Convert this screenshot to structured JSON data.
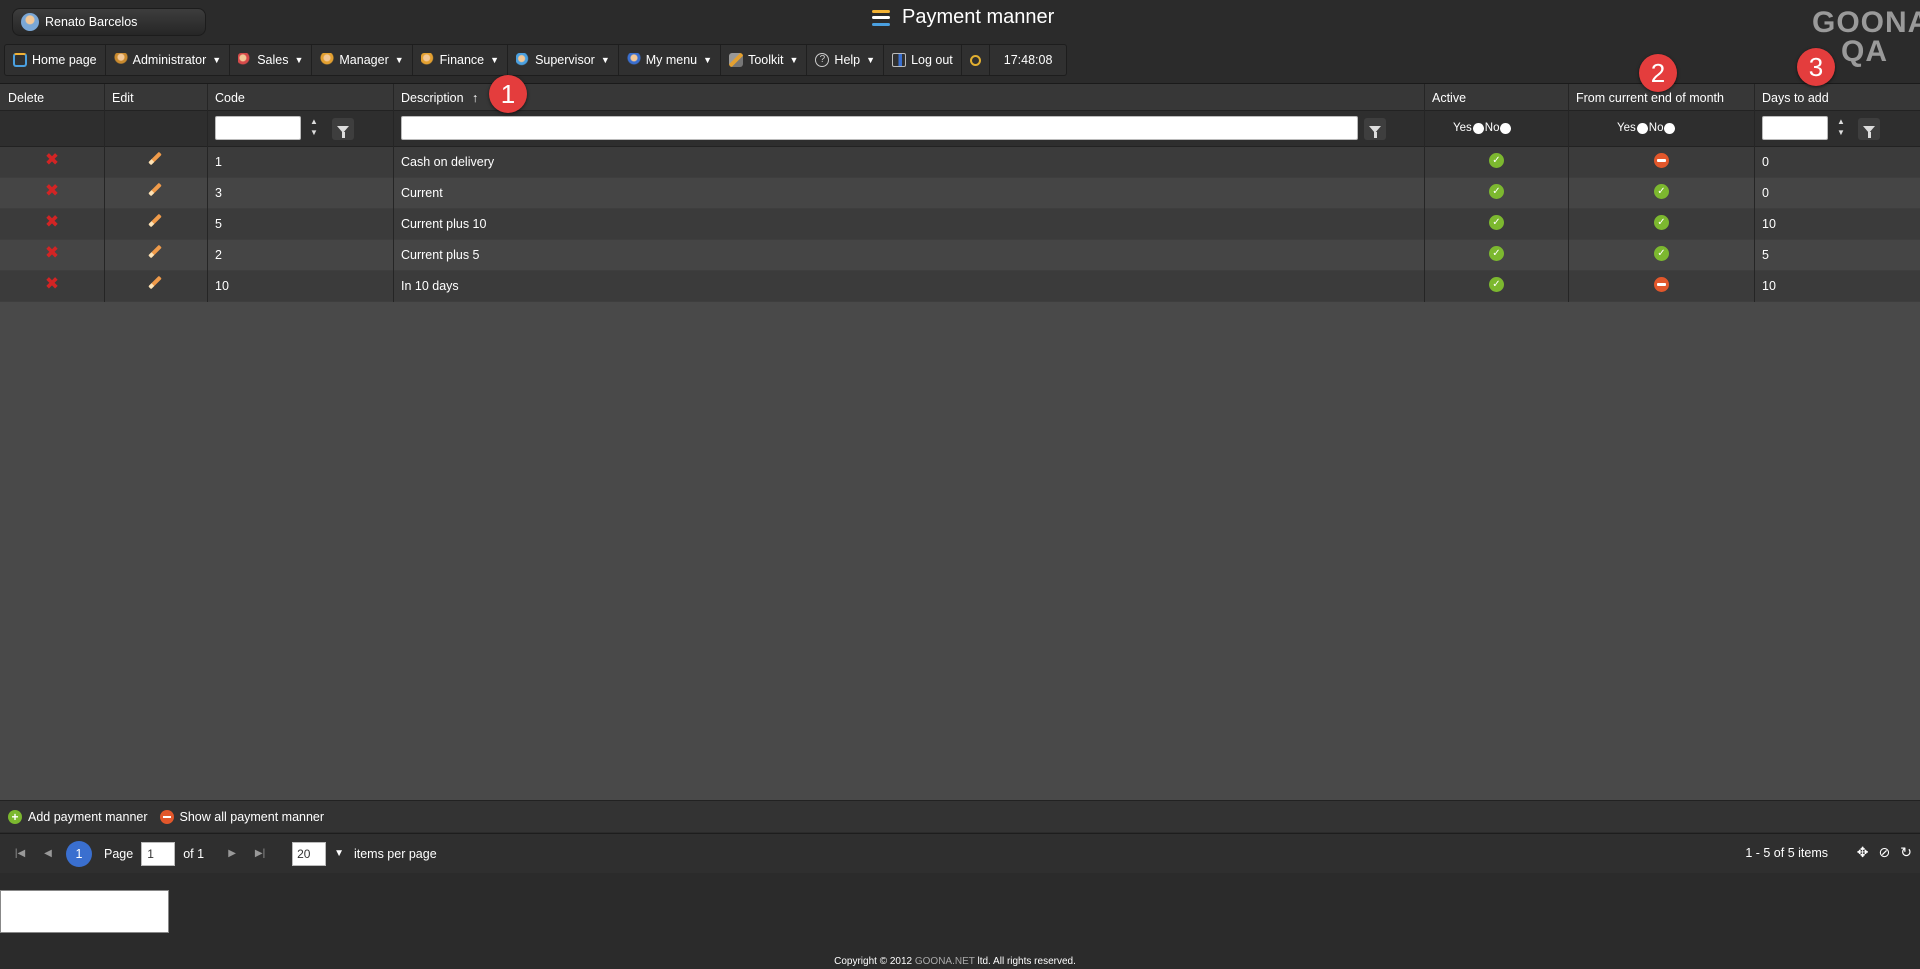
{
  "user": {
    "name": "Renato Barcelos"
  },
  "header": {
    "title": "Payment manner",
    "menu_icon_colors": [
      "#f2b234",
      "#ffffff",
      "#4aa0e0"
    ]
  },
  "logo": {
    "line1": "GOONA",
    "line2": "QA"
  },
  "nav": [
    {
      "label": "Home page",
      "icon": "home-icon",
      "dropdown": false
    },
    {
      "label": "Administrator",
      "icon": "admin-icon",
      "dropdown": true
    },
    {
      "label": "Sales",
      "icon": "sales-icon",
      "dropdown": true
    },
    {
      "label": "Manager",
      "icon": "manager-icon",
      "dropdown": true
    },
    {
      "label": "Finance",
      "icon": "finance-icon",
      "dropdown": true
    },
    {
      "label": "Supervisor",
      "icon": "supervisor-icon",
      "dropdown": true
    },
    {
      "label": "My menu",
      "icon": "my-menu-icon",
      "dropdown": true
    },
    {
      "label": "Toolkit",
      "icon": "toolkit-icon",
      "dropdown": true
    },
    {
      "label": "Help",
      "icon": "help-icon",
      "dropdown": true
    },
    {
      "label": "Log out",
      "icon": "logout-icon",
      "dropdown": false
    }
  ],
  "clock": "17:48:08",
  "grid": {
    "columns": {
      "delete": "Delete",
      "edit": "Edit",
      "code": "Code",
      "description": "Description",
      "sort_indicator": "↑",
      "active": "Active",
      "from_end_of_month": "From current end of month",
      "days_to_add": "Days to add"
    },
    "filters": {
      "yes": "Yes",
      "no": "No"
    },
    "rows": [
      {
        "code": "1",
        "description": "Cash on delivery",
        "active": true,
        "from_end_of_month": false,
        "days_to_add": "0"
      },
      {
        "code": "3",
        "description": "Current",
        "active": true,
        "from_end_of_month": true,
        "days_to_add": "0"
      },
      {
        "code": "5",
        "description": "Current plus 10",
        "active": true,
        "from_end_of_month": true,
        "days_to_add": "10"
      },
      {
        "code": "2",
        "description": "Current plus 5",
        "active": true,
        "from_end_of_month": true,
        "days_to_add": "5"
      },
      {
        "code": "10",
        "description": "In 10 days",
        "active": true,
        "from_end_of_month": false,
        "days_to_add": "10"
      }
    ]
  },
  "badges": [
    "1",
    "2",
    "3"
  ],
  "actions": {
    "add": "Add payment manner",
    "show_all": "Show all payment manner"
  },
  "pager": {
    "current_page": "1",
    "page_label": "Page",
    "page_value": "1",
    "of_label": "of 1",
    "per_page_value": "20",
    "per_page_label": "items per page",
    "info": "1 - 5 of 5 items"
  },
  "footer": {
    "prefix": "Copyright © 2012 ",
    "brand": "GOONA.NET",
    "suffix": " ltd. All rights reserved."
  },
  "colors": {
    "accent_blue": "#3a6fcf",
    "status_yes": "#7cb82f",
    "status_no": "#e2572b",
    "badge": "#e43d3d",
    "delete": "#d22424"
  }
}
